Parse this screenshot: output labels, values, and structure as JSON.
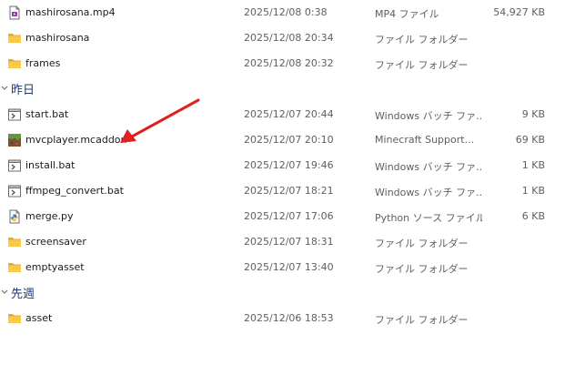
{
  "groups": [
    {
      "label": "",
      "items": [
        {
          "name": "mashirosana.mp4",
          "date": "2025/12/08 0:38",
          "type": "MP4 ファイル",
          "size": "54,927 KB",
          "icon": "video-file-icon"
        },
        {
          "name": "mashirosana",
          "date": "2025/12/08 20:34",
          "type": "ファイル フォルダー",
          "size": "",
          "icon": "folder-icon"
        },
        {
          "name": "frames",
          "date": "2025/12/08 20:32",
          "type": "ファイル フォルダー",
          "size": "",
          "icon": "folder-icon"
        }
      ]
    },
    {
      "label": "昨日",
      "items": [
        {
          "name": "start.bat",
          "date": "2025/12/07 20:44",
          "type": "Windows バッチ ファ...",
          "size": "9 KB",
          "icon": "batch-file-icon"
        },
        {
          "name": "mvcplayer.mcaddon",
          "date": "2025/12/07 20:10",
          "type": "Minecraft Support...",
          "size": "69 KB",
          "icon": "minecraft-file-icon"
        },
        {
          "name": "install.bat",
          "date": "2025/12/07 19:46",
          "type": "Windows バッチ ファ...",
          "size": "1 KB",
          "icon": "batch-file-icon"
        },
        {
          "name": "ffmpeg_convert.bat",
          "date": "2025/12/07 18:21",
          "type": "Windows バッチ ファ...",
          "size": "1 KB",
          "icon": "batch-file-icon"
        },
        {
          "name": "merge.py",
          "date": "2025/12/07 17:06",
          "type": "Python ソース ファイル",
          "size": "6 KB",
          "icon": "python-file-icon"
        },
        {
          "name": "screensaver",
          "date": "2025/12/07 18:31",
          "type": "ファイル フォルダー",
          "size": "",
          "icon": "folder-icon"
        },
        {
          "name": "emptyasset",
          "date": "2025/12/07 13:40",
          "type": "ファイル フォルダー",
          "size": "",
          "icon": "folder-icon"
        }
      ]
    },
    {
      "label": "先週",
      "items": [
        {
          "name": "asset",
          "date": "2025/12/06 18:53",
          "type": "ファイル フォルダー",
          "size": "",
          "icon": "folder-icon"
        }
      ]
    }
  ],
  "annotation": {
    "color": "#e02020",
    "points_to": "mvcplayer.mcaddon"
  }
}
